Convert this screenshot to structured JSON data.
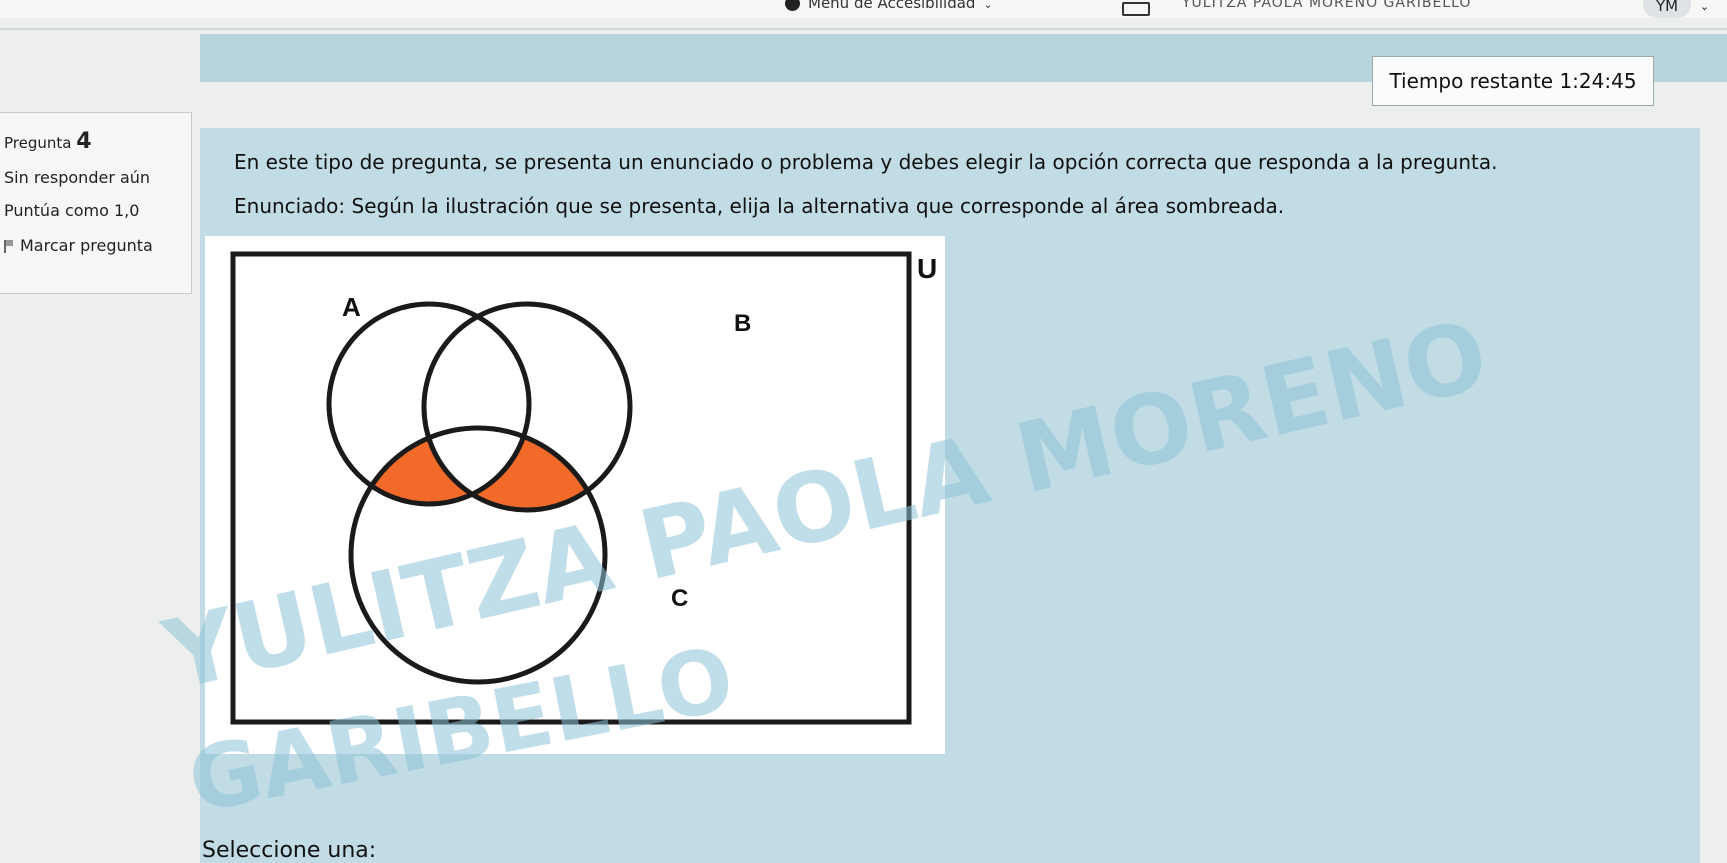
{
  "navbar": {
    "accessibility_menu": "Menú de Accesibilidad",
    "user_name": "YULITZA PAOLA MORENO GARIBELLO",
    "user_initials": "YM"
  },
  "timer": {
    "label": "Tiempo restante 1:24:45"
  },
  "question_info": {
    "label": "Pregunta",
    "number": "4",
    "status": "Sin responder aún",
    "score": "Puntúa como 1,0",
    "flag_label": "Marcar pregunta"
  },
  "question": {
    "intro": "En este tipo de pregunta, se presenta un enunciado o problema y debes elegir la opción correcta que responda a la pregunta.",
    "statement": "Enunciado: Según la ilustración que se presenta, elija la alternativa que corresponde al área sombreada.",
    "select_prompt": "Seleccione una:"
  },
  "venn": {
    "universe_label": "U",
    "set_a_label": "A",
    "set_b_label": "B",
    "set_c_label": "C",
    "shade_color": "#f26a2a",
    "line_color": "#1a1a1a"
  },
  "watermark": {
    "line1": "YULITZA PAOLA MORENO",
    "line2": "GARIBELLO",
    "color": "#8ec4d8"
  }
}
